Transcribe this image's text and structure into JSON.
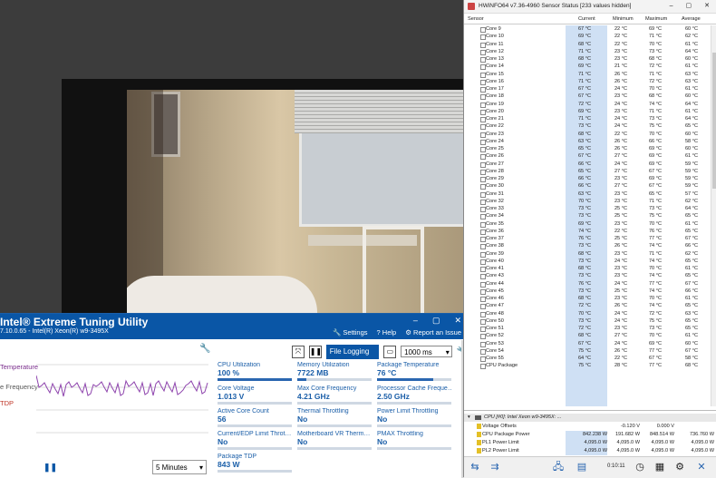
{
  "xtu": {
    "title": "Intel® Extreme Tuning Utility",
    "subtitle": "7.10.0.65 - Intel(R) Xeon(R) w9-3495X",
    "menu": {
      "settings": "Settings",
      "help": "Help",
      "report": "Report an Issue"
    },
    "legend": [
      {
        "label": "Temperature",
        "color": "#7a2d8c"
      },
      {
        "label": "e Frequency",
        "color": "#666666"
      },
      {
        "label": "TDP",
        "color": "#c0392b"
      }
    ],
    "file_logging": "File Logging ▶",
    "interval": "1000 ms",
    "time_window": "5 Minutes",
    "metrics": [
      {
        "label": "CPU Utilization",
        "value": "100 %",
        "fill": 1.0
      },
      {
        "label": "Memory Utilization",
        "value": "7722  MB",
        "fill": 0.12
      },
      {
        "label": "Package Temperature",
        "value": "76 °C",
        "fill": 0.76
      },
      {
        "label": "Core Voltage",
        "value": "1.013 V",
        "fill": 0.0
      },
      {
        "label": "Max Core Frequency",
        "value": "4.21 GHz",
        "fill": 0.0
      },
      {
        "label": "Processor Cache Freque…",
        "value": "2.50 GHz",
        "fill": 0.0
      },
      {
        "label": "Active Core Count",
        "value": "56",
        "fill": 0.0
      },
      {
        "label": "Thermal Throttling",
        "value": "No",
        "fill": 0.0
      },
      {
        "label": "Power Limit Throttling",
        "value": "No",
        "fill": 0.0
      },
      {
        "label": "Current/EDP Limit Throt…",
        "value": "No",
        "fill": 0.0
      },
      {
        "label": "Motherboard VR Therm…",
        "value": "No",
        "fill": 0.0
      },
      {
        "label": "PMAX Throttling",
        "value": "No",
        "fill": 0.0
      },
      {
        "label": "Package TDP",
        "value": "843 W",
        "fill": 0.0
      }
    ]
  },
  "hwinfo": {
    "title": "HWiNFO64 v7.36-4960 Sensor Status [233 values hidden]",
    "columns": [
      "Sensor",
      "Current",
      "Minimum",
      "Maximum",
      "Average"
    ],
    "cores": [
      [
        "Core 9",
        "67 °C",
        "22 °C",
        "69 °C",
        "60 °C"
      ],
      [
        "Core 10",
        "69 °C",
        "22 °C",
        "71 °C",
        "62 °C"
      ],
      [
        "Core 11",
        "68 °C",
        "22 °C",
        "70 °C",
        "61 °C"
      ],
      [
        "Core 12",
        "71 °C",
        "23 °C",
        "73 °C",
        "64 °C"
      ],
      [
        "Core 13",
        "68 °C",
        "23 °C",
        "68 °C",
        "60 °C"
      ],
      [
        "Core 14",
        "69 °C",
        "21 °C",
        "72 °C",
        "61 °C"
      ],
      [
        "Core 15",
        "71 °C",
        "26 °C",
        "71 °C",
        "63 °C"
      ],
      [
        "Core 16",
        "71 °C",
        "26 °C",
        "72 °C",
        "63 °C"
      ],
      [
        "Core 17",
        "67 °C",
        "24 °C",
        "70 °C",
        "61 °C"
      ],
      [
        "Core 18",
        "67 °C",
        "23 °C",
        "68 °C",
        "60 °C"
      ],
      [
        "Core 19",
        "72 °C",
        "24 °C",
        "74 °C",
        "64 °C"
      ],
      [
        "Core 20",
        "69 °C",
        "23 °C",
        "71 °C",
        "61 °C"
      ],
      [
        "Core 21",
        "71 °C",
        "24 °C",
        "73 °C",
        "64 °C"
      ],
      [
        "Core 22",
        "73 °C",
        "24 °C",
        "75 °C",
        "65 °C"
      ],
      [
        "Core 23",
        "68 °C",
        "22 °C",
        "70 °C",
        "60 °C"
      ],
      [
        "Core 24",
        "63 °C",
        "26 °C",
        "66 °C",
        "58 °C"
      ],
      [
        "Core 25",
        "65 °C",
        "26 °C",
        "69 °C",
        "60 °C"
      ],
      [
        "Core 26",
        "67 °C",
        "27 °C",
        "69 °C",
        "61 °C"
      ],
      [
        "Core 27",
        "66 °C",
        "24 °C",
        "69 °C",
        "59 °C"
      ],
      [
        "Core 28",
        "65 °C",
        "27 °C",
        "67 °C",
        "59 °C"
      ],
      [
        "Core 29",
        "66 °C",
        "23 °C",
        "69 °C",
        "59 °C"
      ],
      [
        "Core 30",
        "66 °C",
        "27 °C",
        "67 °C",
        "59 °C"
      ],
      [
        "Core 31",
        "63 °C",
        "23 °C",
        "65 °C",
        "57 °C"
      ],
      [
        "Core 32",
        "70 °C",
        "23 °C",
        "71 °C",
        "62 °C"
      ],
      [
        "Core 33",
        "73 °C",
        "25 °C",
        "73 °C",
        "64 °C"
      ],
      [
        "Core 34",
        "73 °C",
        "25 °C",
        "75 °C",
        "65 °C"
      ],
      [
        "Core 35",
        "69 °C",
        "23 °C",
        "70 °C",
        "61 °C"
      ],
      [
        "Core 36",
        "74 °C",
        "22 °C",
        "76 °C",
        "65 °C"
      ],
      [
        "Core 37",
        "76 °C",
        "25 °C",
        "77 °C",
        "67 °C"
      ],
      [
        "Core 38",
        "73 °C",
        "26 °C",
        "74 °C",
        "66 °C"
      ],
      [
        "Core 39",
        "68 °C",
        "23 °C",
        "71 °C",
        "62 °C"
      ],
      [
        "Core 40",
        "73 °C",
        "24 °C",
        "74 °C",
        "65 °C"
      ],
      [
        "Core 41",
        "68 °C",
        "23 °C",
        "70 °C",
        "61 °C"
      ],
      [
        "Core 43",
        "73 °C",
        "23 °C",
        "74 °C",
        "65 °C"
      ],
      [
        "Core 44",
        "76 °C",
        "24 °C",
        "77 °C",
        "67 °C"
      ],
      [
        "Core 45",
        "73 °C",
        "25 °C",
        "74 °C",
        "66 °C"
      ],
      [
        "Core 46",
        "68 °C",
        "23 °C",
        "70 °C",
        "61 °C"
      ],
      [
        "Core 47",
        "72 °C",
        "26 °C",
        "74 °C",
        "65 °C"
      ],
      [
        "Core 48",
        "70 °C",
        "24 °C",
        "72 °C",
        "63 °C"
      ],
      [
        "Core 50",
        "73 °C",
        "24 °C",
        "75 °C",
        "65 °C"
      ],
      [
        "Core 51",
        "72 °C",
        "23 °C",
        "73 °C",
        "65 °C"
      ],
      [
        "Core 52",
        "68 °C",
        "27 °C",
        "70 °C",
        "61 °C"
      ],
      [
        "Core 53",
        "67 °C",
        "24 °C",
        "69 °C",
        "60 °C"
      ],
      [
        "Core 54",
        "75 °C",
        "26 °C",
        "77 °C",
        "67 °C"
      ],
      [
        "Core 55",
        "64 °C",
        "22 °C",
        "67 °C",
        "58 °C"
      ],
      [
        "CPU Package",
        "75 °C",
        "28 °C",
        "77 °C",
        "68 °C"
      ]
    ],
    "group_title": "CPU [#0]: Intel Xeon w9-3495X: ...",
    "power_rows": [
      [
        "Voltage Offsets",
        "",
        "-0.120 V",
        "0.000 V",
        ""
      ],
      [
        "CPU Package Power",
        "842.238 W",
        "191.682 W",
        "848.514 W",
        "736.760 W"
      ],
      [
        "PL1 Power Limit",
        "4,095.0 W",
        "4,095.0 W",
        "4,095.0 W",
        "4,095.0 W"
      ],
      [
        "PL2 Power Limit",
        "4,095.0 W",
        "4,095.0 W",
        "4,095.0 W",
        "4,095.0 W"
      ]
    ],
    "elapsed": "0:10:11"
  }
}
